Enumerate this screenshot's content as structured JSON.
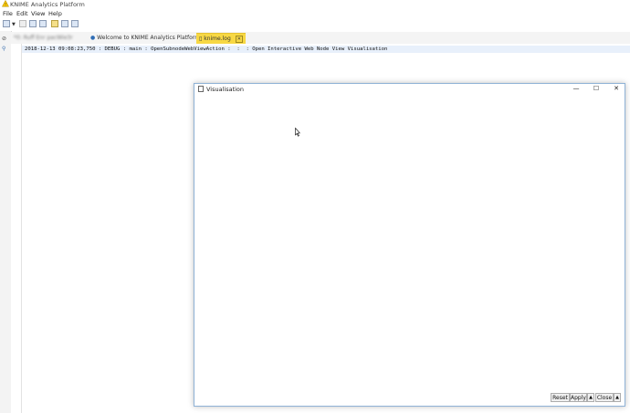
{
  "app": {
    "title": "KNIME Analytics Platform"
  },
  "menu": {
    "items": [
      "File",
      "Edit",
      "View",
      "Help"
    ]
  },
  "tabs": [
    {
      "label": "*0: Ruff Enr pacWie3r",
      "blurred": true
    },
    {
      "label": "Welcome to KNIME Analytics Platform"
    },
    {
      "label": "knime.log",
      "active": true
    }
  ],
  "editor": {
    "log_line": "2018-12-13 09:08:23,750 : DEBUG : main : OpenSubnodeWebViewAction :  :  : Open Interactive Web Node View Visualisation"
  },
  "dialog": {
    "title": "Visualisation",
    "controls": {
      "minimize": "—",
      "maximize": "☐",
      "close": "✕"
    },
    "buttons": {
      "reset": "Reset",
      "apply": "Apply",
      "apply_arrow": "▲",
      "close": "Close",
      "close_arrow": "▲"
    }
  },
  "colors": {
    "active_tab": "#f7d844",
    "log_highlight": "#e8f0fb",
    "dialog_border": "#8fb2d6"
  }
}
